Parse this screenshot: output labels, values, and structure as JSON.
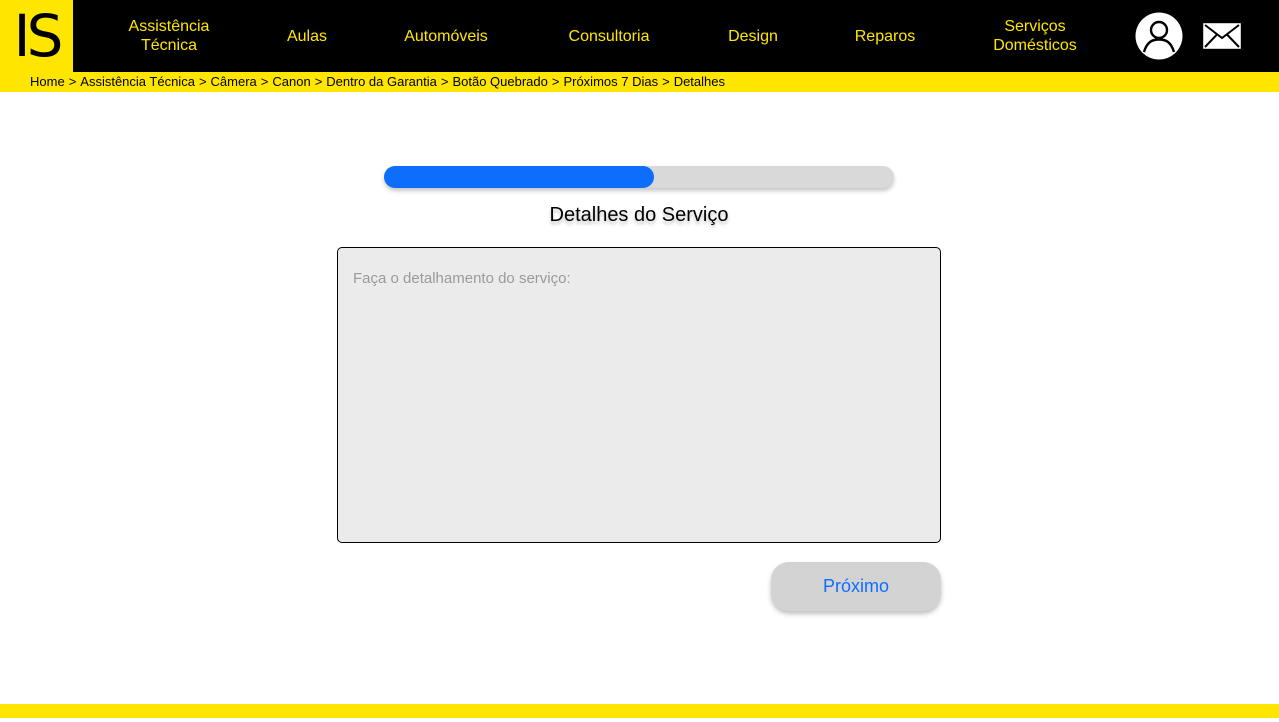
{
  "brand": {
    "logo_text": "IS",
    "primary_color": "#FFE600",
    "header_bg": "#000000",
    "accent_color": "#0D6EFD"
  },
  "nav": {
    "items": [
      {
        "label": "Assistência\nTécnica"
      },
      {
        "label": "Aulas"
      },
      {
        "label": "Automóveis"
      },
      {
        "label": "Consultoria"
      },
      {
        "label": "Design"
      },
      {
        "label": "Reparos"
      },
      {
        "label": "Serviços\nDomésticos"
      }
    ],
    "icons": [
      "user-avatar-icon",
      "mail-icon"
    ]
  },
  "breadcrumb": {
    "items": [
      "Home",
      "Assistência Técnica",
      "Câmera",
      "Canon",
      "Dentro da Garantia",
      "Botão Quebrado",
      "Próximos 7 Dias",
      "Detalhes"
    ],
    "separator": ">"
  },
  "form": {
    "progress_fraction": 0.53,
    "title": "Detalhes do Serviço",
    "details_placeholder": "Faça o detalhamento do serviço:",
    "details_value": "",
    "next_label": "Próximo"
  }
}
